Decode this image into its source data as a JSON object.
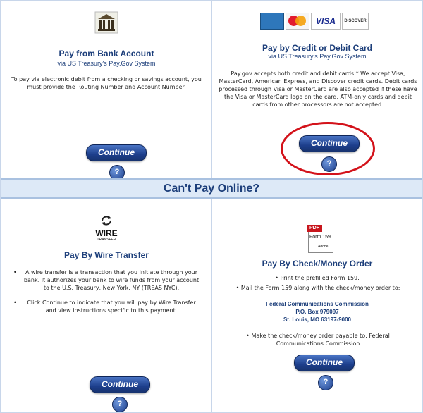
{
  "bank": {
    "title": "Pay from Bank Account",
    "subtitle": "via US Treasury's Pay.Gov System",
    "description": "To pay via electronic debit from a checking or savings account, you must provide the Routing Number and Account Number.",
    "continue_label": "Continue",
    "help_label": "?"
  },
  "card": {
    "logos": [
      "AMEX",
      "MC",
      "VISA",
      "DISCOVER"
    ],
    "title": "Pay by Credit or Debit Card",
    "subtitle": "via US Treasury's Pay.Gov System",
    "description": "Pay.gov accepts both credit and debit cards.* We accept Visa, MasterCard, American Express, and Discover credit cards. Debit cards processed through Visa or MasterCard are also accepted if these have the Visa or MasterCard logo on the card. ATM-only cards and debit cards from other processors are not accepted.",
    "continue_label": "Continue",
    "help_label": "?"
  },
  "offline": {
    "heading": "Can't Pay Online?"
  },
  "wire": {
    "logo_text": "WIRE",
    "logo_subtext": "TRANSFER",
    "title": "Pay By Wire Transfer",
    "bullets": [
      "A wire transfer is a transaction that you initiate through your bank. It authorizes your bank to wire funds from your account to the U.S. Treasury, New York, NY (TREAS NYC).",
      "Click Continue to indicate that you will pay by Wire Transfer and view instructions specific to this payment."
    ],
    "continue_label": "Continue",
    "help_label": "?"
  },
  "check": {
    "pdf_badge": "PDF",
    "form_label": "Form 159",
    "adobe_label": "Adobe",
    "title": "Pay By Check/Money Order",
    "bullet1": "Print the prefilled Form 159.",
    "bullet2": "Mail the Form 159 along with the check/money order to:",
    "address": [
      "Federal Communications Commission",
      "P.O. Box 979097",
      "St. Louis, MO 63197-9000"
    ],
    "bullet3": "Make the check/money order payable to: Federal Communications Commission",
    "continue_label": "Continue",
    "help_label": "?"
  },
  "colors": {
    "accent": "#1c3e7a",
    "button": "#1d3f8c",
    "highlight": "#d3121a",
    "banner_bg": "#dde9f7"
  }
}
